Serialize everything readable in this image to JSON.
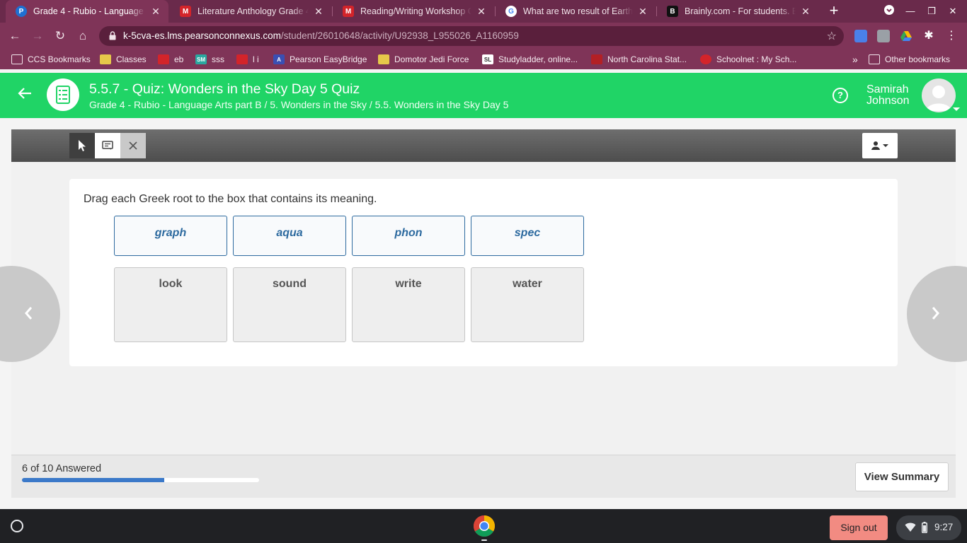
{
  "browser": {
    "tabs": [
      {
        "title": "Grade 4 - Rubio - Language Arts part B",
        "favicon": "pearson-icon",
        "active": true
      },
      {
        "title": "Literature Anthology Grade 4",
        "favicon": "mcgraw-hill-icon",
        "active": false
      },
      {
        "title": "Reading/Writing Workshop Grade 4",
        "favicon": "mcgraw-hill-icon",
        "active": false
      },
      {
        "title": "What are two result of Earth tr",
        "favicon": "google-icon",
        "active": false
      },
      {
        "title": "Brainly.com - For students. By",
        "favicon": "brainly-icon",
        "active": false
      }
    ],
    "url_host": "k-5cva-es.lms.pearsonconnexus.com",
    "url_path": "/student/26010648/activity/U92938_L955026_A1160959",
    "bookmarks": [
      {
        "label": "CCS Bookmarks",
        "icon": "folder-icon"
      },
      {
        "label": "Classes",
        "icon": "classes-icon"
      },
      {
        "label": "eb",
        "icon": "mcgraw-hill-icon"
      },
      {
        "label": "sss",
        "icon": "sm-icon"
      },
      {
        "label": "l i",
        "icon": "mcgraw-hill-icon"
      },
      {
        "label": "Pearson EasyBridge",
        "icon": "pearson-a-icon"
      },
      {
        "label": "Domotor Jedi Force",
        "icon": "classes-icon"
      },
      {
        "label": "Studyladder, online...",
        "icon": "studyladder-icon"
      },
      {
        "label": "North Carolina Stat...",
        "icon": "nc-state-icon"
      },
      {
        "label": "Schoolnet : My Sch...",
        "icon": "schoolnet-icon"
      }
    ],
    "overflow_label": "»",
    "other_bookmarks": "Other bookmarks"
  },
  "header": {
    "title": "5.5.7 - Quiz: Wonders in the Sky Day 5 Quiz",
    "breadcrumb": "Grade 4 - Rubio - Language Arts part B / 5. Wonders in the Sky / 5.5. Wonders in the Sky Day 5",
    "help": "?",
    "user_first": "Samirah",
    "user_last": "Johnson"
  },
  "question": {
    "prompt": "Drag each Greek root to the box that contains its meaning.",
    "roots": [
      "graph",
      "aqua",
      "phon",
      "spec"
    ],
    "meanings": [
      "look",
      "sound",
      "write",
      "water"
    ]
  },
  "footer": {
    "answered_text": "6 of 10 Answered",
    "answered": 6,
    "total": 10,
    "view_summary": "View Summary"
  },
  "shelf": {
    "sign_out": "Sign out",
    "time": "9:27"
  },
  "colors": {
    "header_green": "#20d466",
    "root_blue": "#2d6a9f",
    "progress_blue": "#3b79c9",
    "browser_purple": "#7f3458"
  }
}
